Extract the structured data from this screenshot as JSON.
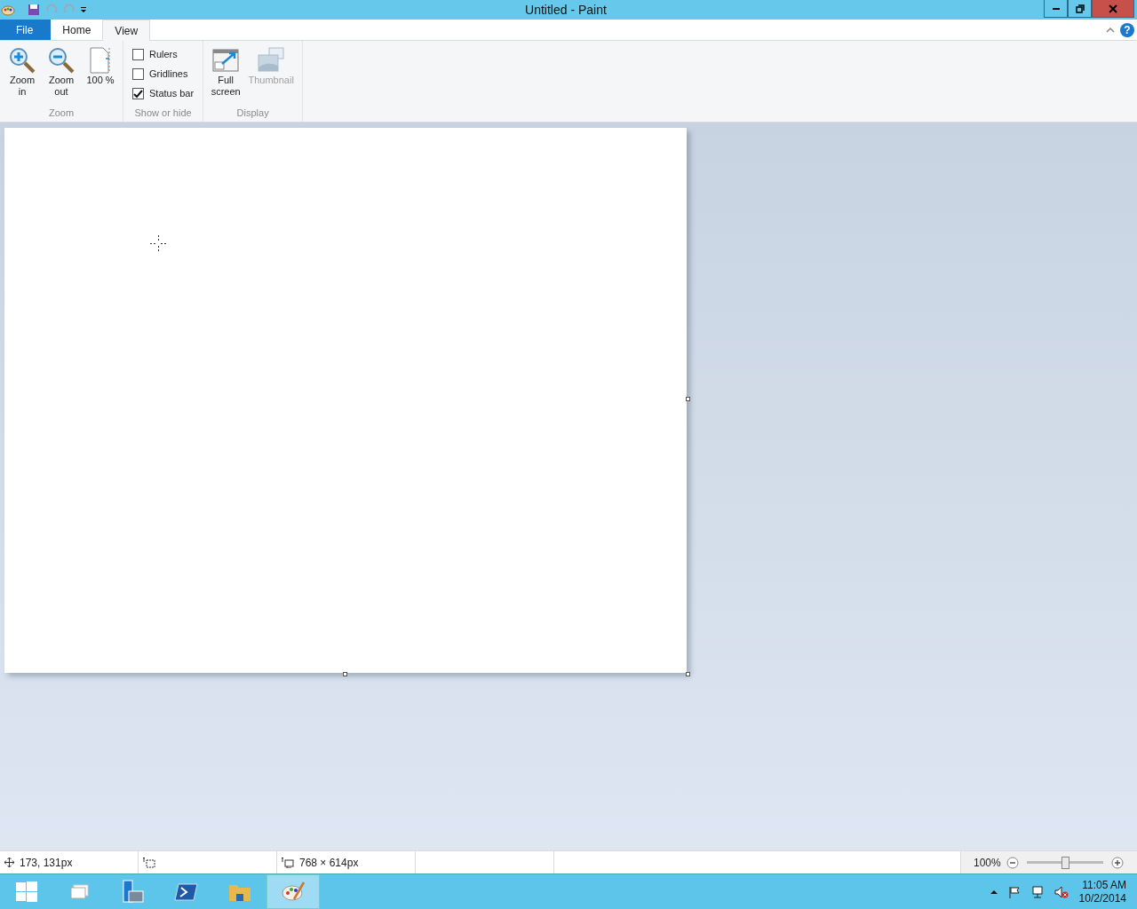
{
  "window": {
    "title": "Untitled - Paint",
    "help_button": "?"
  },
  "tabs": [
    {
      "label": "File",
      "kind": "file",
      "selected": false
    },
    {
      "label": "Home",
      "kind": "tab",
      "selected": false
    },
    {
      "label": "View",
      "kind": "tab",
      "selected": true
    }
  ],
  "ribbon": {
    "zoom_group": {
      "label": "Zoom",
      "buttons": [
        {
          "label": "Zoom in",
          "kind": "zoom-in"
        },
        {
          "label": "Zoom out",
          "kind": "zoom-out"
        },
        {
          "label": "100 %",
          "kind": "actual-size"
        }
      ]
    },
    "show_or_hide_group": {
      "label": "Show or hide",
      "checkboxes": [
        {
          "label": "Rulers",
          "checked": false
        },
        {
          "label": "Gridlines",
          "checked": false
        },
        {
          "label": "Status bar",
          "checked": true
        }
      ]
    },
    "display_group": {
      "label": "Display",
      "buttons": [
        {
          "label": "Full screen",
          "kind": "full-screen",
          "disabled": false
        },
        {
          "label": "Thumbnail",
          "kind": "thumbnail",
          "disabled": true
        }
      ]
    }
  },
  "status_bar": {
    "cursor_position": "173, 131px",
    "image_size": "768 × 614px",
    "zoom": "100%",
    "zoom_slider": {
      "level": 0.52
    }
  },
  "taskbar": {
    "apps": [
      {
        "kind": "start",
        "selected": false
      },
      {
        "kind": "task-view",
        "selected": false
      },
      {
        "kind": "server-manager",
        "selected": false
      },
      {
        "kind": "powershell",
        "selected": false
      },
      {
        "kind": "explorer",
        "selected": false
      },
      {
        "kind": "paint",
        "selected": true
      }
    ],
    "time": "11:05 AM",
    "date": "10/2/2014"
  }
}
